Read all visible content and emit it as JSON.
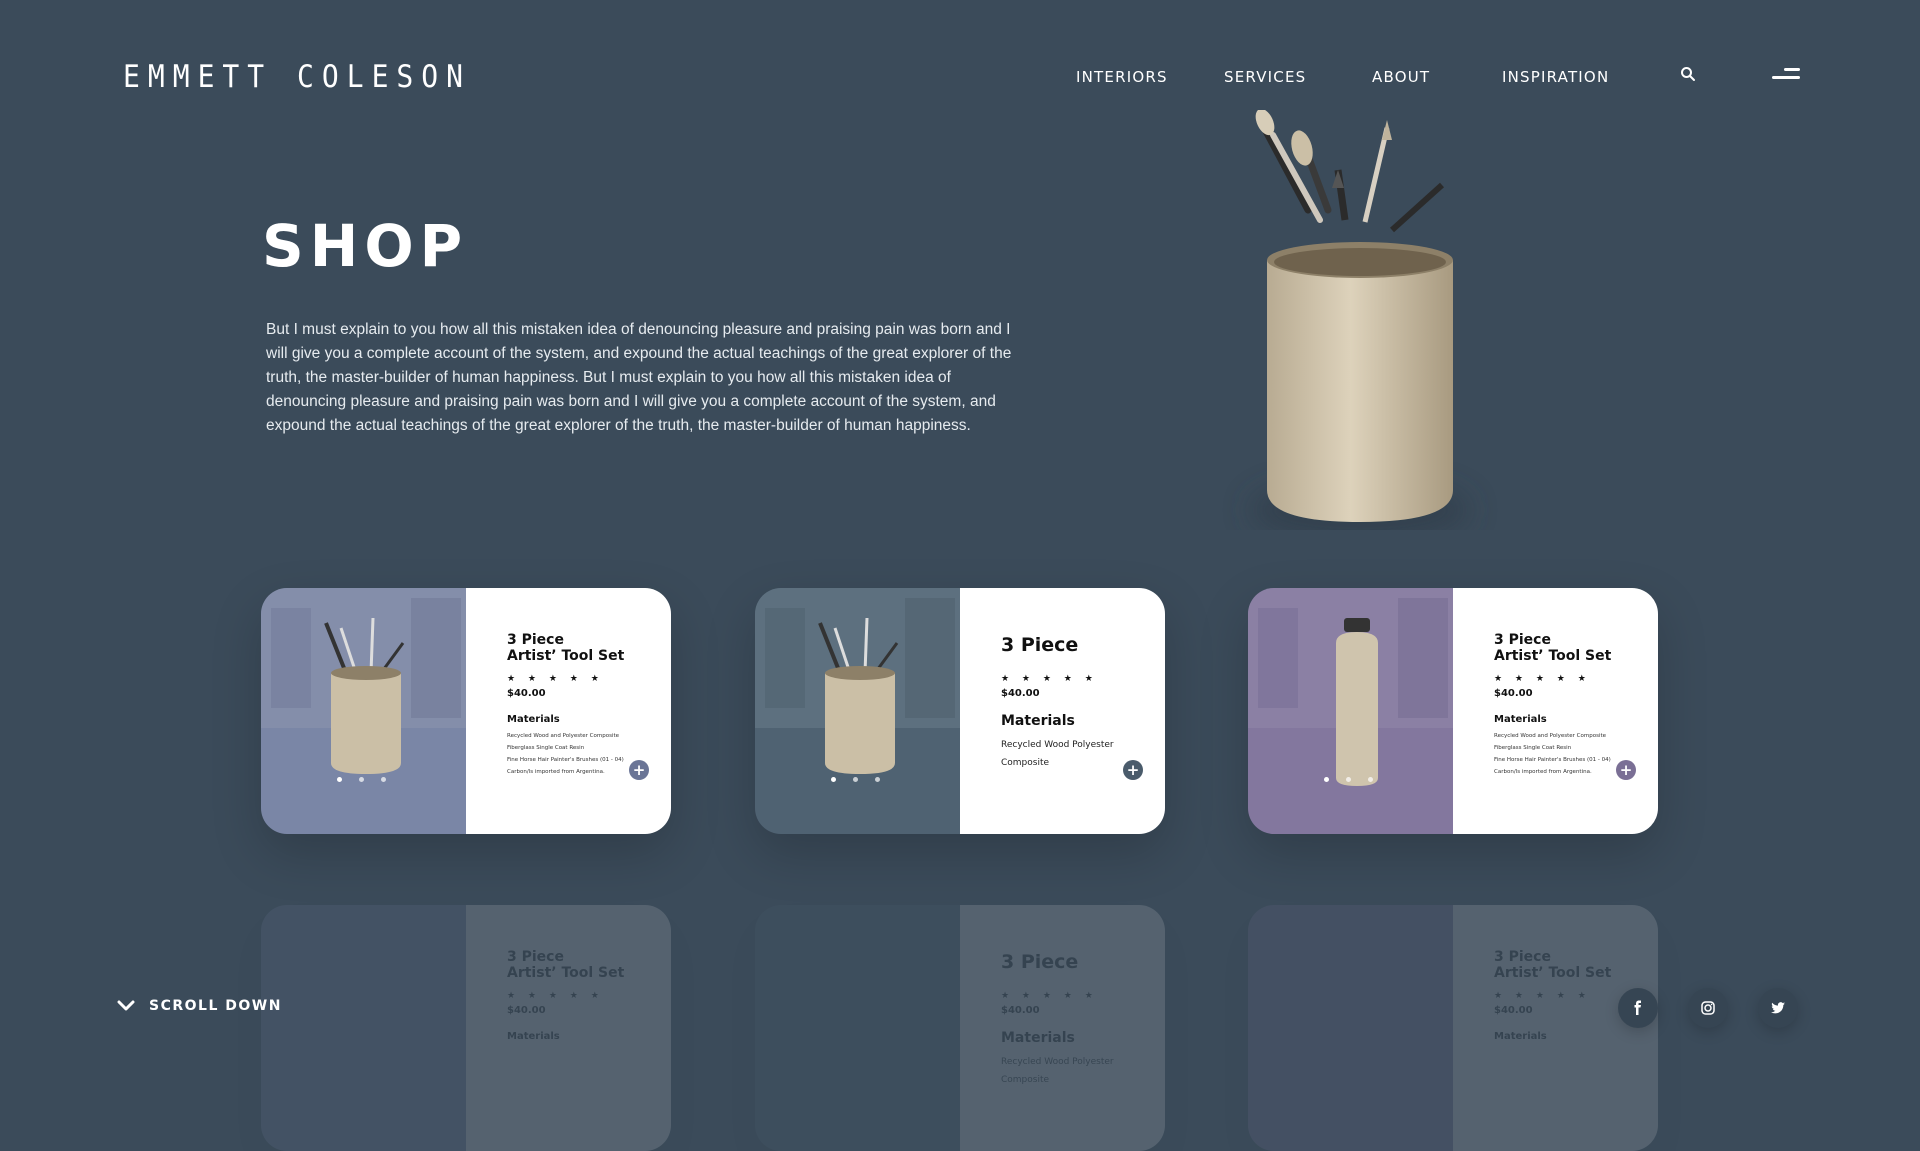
{
  "brand": {
    "logo": "EMMETT COLESON"
  },
  "nav": {
    "items": [
      "INTERIORS",
      "SERVICES",
      "ABOUT",
      "INSPIRATION"
    ]
  },
  "icons": {
    "search": "search-icon",
    "menu": "menu-icon",
    "scroll": "chevron-down-icon"
  },
  "hero": {
    "title": "SHOP",
    "intro": "But I must explain to you how all this mistaken idea of denouncing pleasure and praising pain was born and I will give you a complete account of the system, and expound the actual teachings of the great explorer of the truth, the master-builder of human happiness. But I must explain to you how all this mistaken idea of denouncing pleasure and praising pain was born and I will give you a complete account of the system, and expound the actual teachings of the great explorer of the truth, the master-builder of human happiness."
  },
  "cards": [
    {
      "title_line1": "3 Piece",
      "title_line2": "Artist’ Tool Set",
      "stars": "★ ★ ★ ★ ★",
      "price": "$40.00",
      "materials_heading": "Materials",
      "materials": [
        "Recycled Wood and Polyester Composite",
        "Fiberglass Single Coat Resin",
        "Fine Horse Hair Painter's Brushes (01 - 04)",
        "Carbon/ls imported from Argentina."
      ],
      "bg_color": "#7a86a6",
      "plus_color": "#6a7596"
    },
    {
      "title_line1": "3 Piece",
      "stars": "★ ★ ★ ★ ★",
      "price": "$40.00",
      "materials_heading": "Materials",
      "materials_text": "Recycled Wood Polyester Composite",
      "bg_color": "#4f6272",
      "plus_color": "#4a5b6b"
    },
    {
      "title_line1": "3 Piece",
      "title_line2": "Artist’ Tool Set",
      "stars": "★ ★ ★ ★ ★",
      "price": "$40.00",
      "materials_heading": "Materials",
      "materials": [
        "Recycled Wood and Polyester Composite",
        "Fiberglass Single Coat Resin",
        "Fine Horse Hair Painter's Brushes (01 - 04)",
        "Carbon/ls imported from Argentina."
      ],
      "bg_color": "#83779e",
      "plus_color": "#7a6f95"
    }
  ],
  "footer": {
    "scroll_label": "SCROLL DOWN",
    "social": [
      "facebook-icon",
      "instagram-icon",
      "twitter-icon"
    ]
  },
  "colors": {
    "background": "#3b4b5a",
    "card_info": "#ffffff"
  }
}
